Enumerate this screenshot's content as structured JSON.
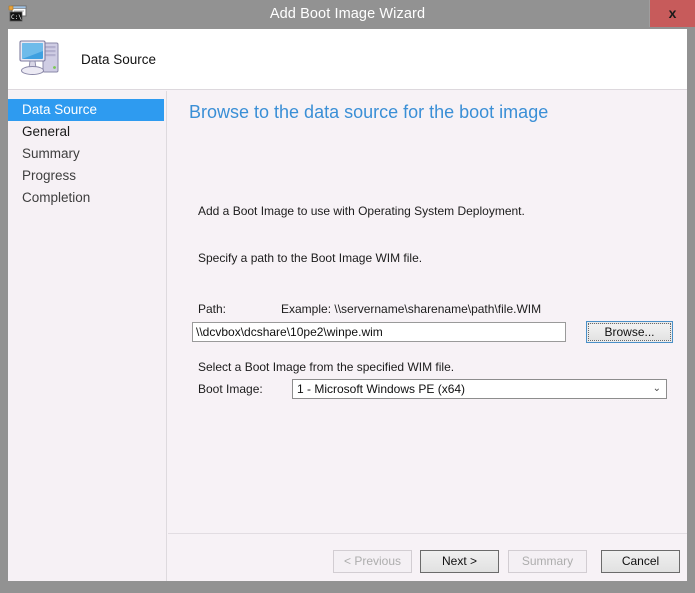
{
  "window": {
    "title": "Add Boot Image Wizard",
    "app_icon": "console-window-icon",
    "close_label": "x",
    "frame_color": "#929292",
    "client_bg": "#f7f2f6"
  },
  "banner": {
    "icon": "computer-icon",
    "title": "Data Source"
  },
  "sidebar": {
    "items": [
      {
        "label": "Data Source",
        "state": "selected"
      },
      {
        "label": "General",
        "state": "done"
      },
      {
        "label": "Summary",
        "state": "pending"
      },
      {
        "label": "Progress",
        "state": "pending"
      },
      {
        "label": "Completion",
        "state": "pending"
      }
    ],
    "selected_color": "#2e9bf0"
  },
  "content": {
    "heading": "Browse to the data source for the boot image",
    "heading_color": "#3a8fd6",
    "intro_text": "Add a Boot Image to use with Operating System Deployment.",
    "specify_text": "Specify a path to the Boot Image WIM file.",
    "path_label": "Path:",
    "path_example": "Example: \\\\servername\\sharename\\path\\file.WIM",
    "path_value": "\\\\dcvbox\\dcshare\\10pe2\\winpe.wim",
    "path_placeholder": "",
    "browse_label": "Browse...",
    "select_text": "Select a Boot Image from the specified WIM file.",
    "bootimage_label": "Boot Image:",
    "bootimage_selected": "1 - Microsoft Windows PE (x64)",
    "bootimage_options": [
      "1 - Microsoft Windows PE (x64)"
    ],
    "dropdown_arrow": "⌄"
  },
  "footer": {
    "buttons": [
      {
        "label": "< Previous",
        "enabled": false
      },
      {
        "label": "Next >",
        "enabled": true
      },
      {
        "label": "Summary",
        "enabled": false
      },
      {
        "label": "Cancel",
        "enabled": true
      }
    ]
  }
}
